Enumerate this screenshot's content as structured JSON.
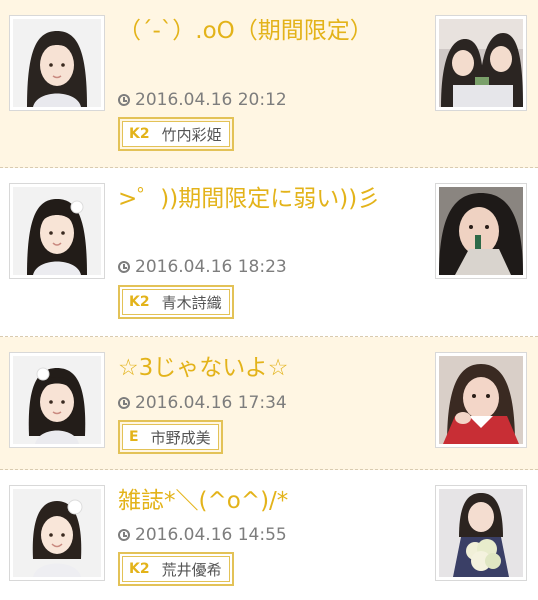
{
  "posts": [
    {
      "title": "（´-`）.oO（期間限定）",
      "datetime": "2016.04.16 20:12",
      "team": "K2",
      "member": "竹内彩姫",
      "avatar_icon": "member-portrait",
      "thumb_icon": "photo-thumbnail"
    },
    {
      "title": ">゜))期間限定に弱い))彡",
      "datetime": "2016.04.16 18:23",
      "team": "K2",
      "member": "青木詩織",
      "avatar_icon": "member-portrait",
      "thumb_icon": "photo-thumbnail"
    },
    {
      "title": "☆3じゃないよ☆",
      "datetime": "2016.04.16 17:34",
      "team": "E",
      "member": "市野成美",
      "avatar_icon": "member-portrait",
      "thumb_icon": "photo-thumbnail"
    },
    {
      "title": "雑誌*＼(^o^)/*",
      "datetime": "2016.04.16 14:55",
      "team": "K2",
      "member": "荒井優希",
      "avatar_icon": "member-portrait",
      "thumb_icon": "photo-thumbnail"
    }
  ],
  "colors": {
    "title": "#e3b31a",
    "alt_background": "#fff6e3",
    "tag_border": "#e3c257",
    "meta_text": "#7d7d7d"
  }
}
